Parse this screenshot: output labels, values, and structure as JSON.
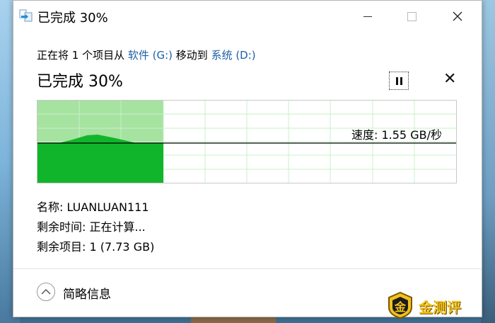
{
  "window": {
    "title": "已完成 30%"
  },
  "operation": {
    "prefix": "正在将 1 个项目从 ",
    "source": "软件 (G:)",
    "middle": " 移动到 ",
    "destination": "系统 (D:)"
  },
  "progress": {
    "label": "已完成 30%",
    "fraction": 0.3,
    "speed_label": "速度: 1.55 GB/秒"
  },
  "details": {
    "name": "名称: LUANLUAN111",
    "time_remaining": "剩余时间: 正在计算...",
    "items_remaining": "剩余项目: 1 (7.73 GB)"
  },
  "footer": {
    "collapse_label": "简略信息"
  },
  "watermark": {
    "text": "金测评"
  },
  "colors": {
    "progress_fill": "#a6e2a0",
    "speed_fill": "#11b52b",
    "grid": "#c8f0c8",
    "link": "#1e5fa8"
  }
}
